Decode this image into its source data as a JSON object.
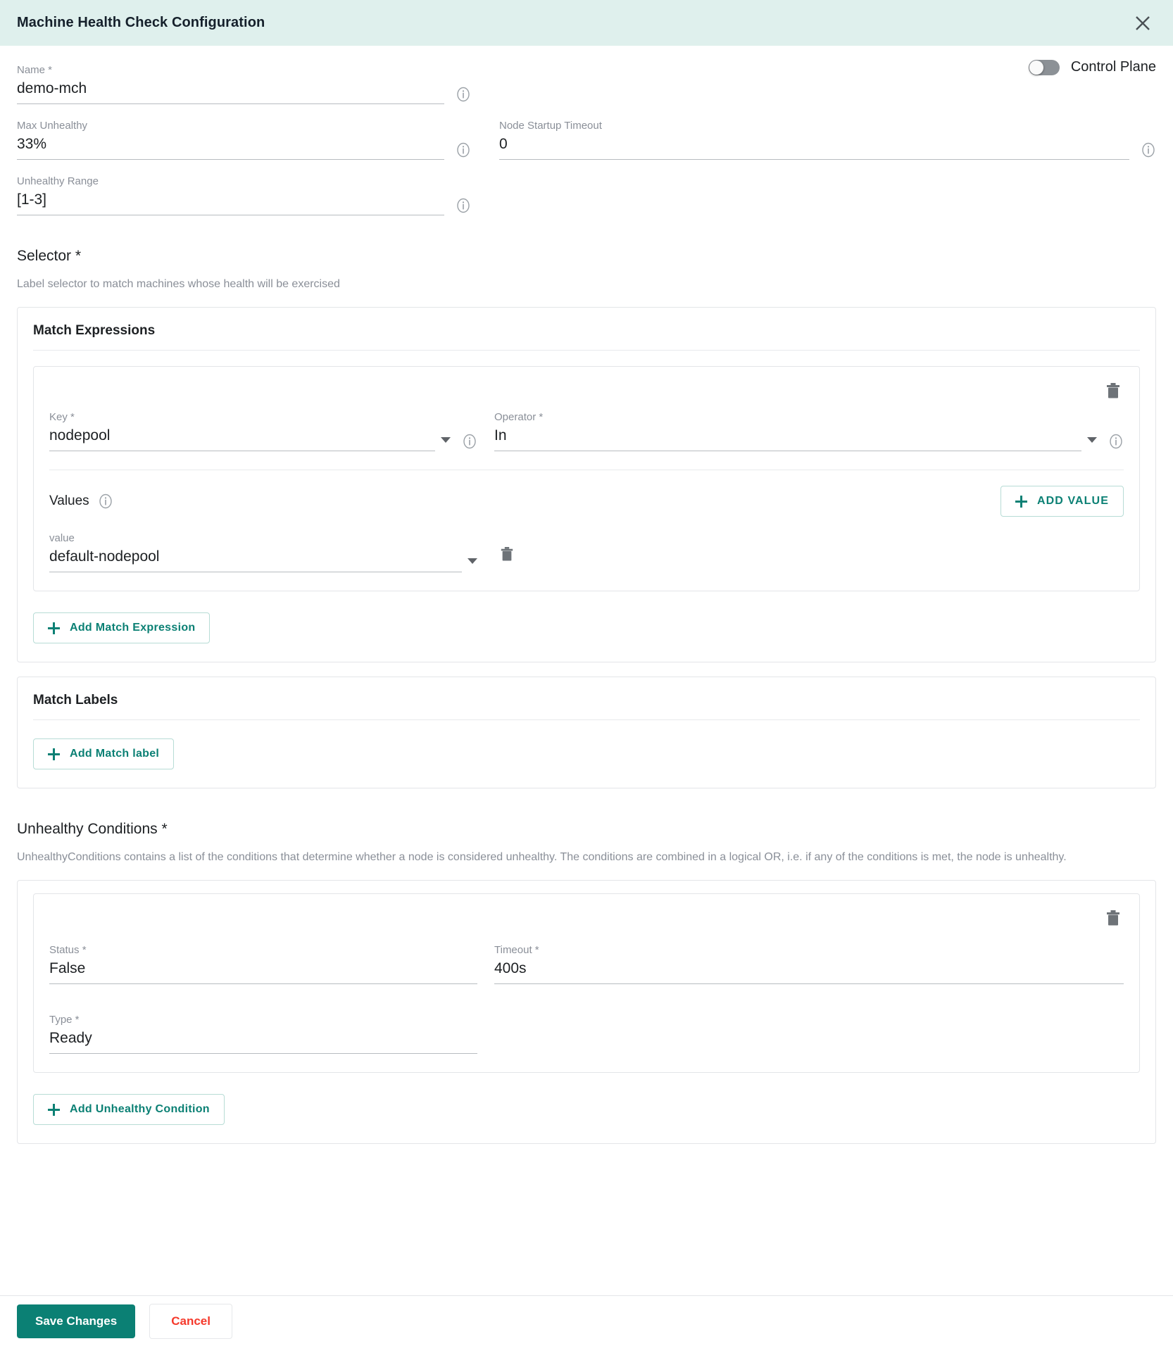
{
  "header": {
    "title": "Machine Health Check Configuration",
    "close_icon": "close-icon"
  },
  "toggle": {
    "label": "Control Plane",
    "state": "off"
  },
  "fields": {
    "name": {
      "label": "Name *",
      "value": "demo-mch"
    },
    "max_unhealthy": {
      "label": "Max Unhealthy",
      "value": "33%"
    },
    "node_startup_timeout": {
      "label": "Node Startup Timeout",
      "value": "0"
    },
    "unhealthy_range": {
      "label": "Unhealthy Range",
      "value": "[1-3]"
    }
  },
  "selector": {
    "title": "Selector *",
    "description": "Label selector to match machines whose health will be exercised",
    "match_expressions": {
      "heading": "Match Expressions",
      "expressions": [
        {
          "key": {
            "label": "Key *",
            "value": "nodepool"
          },
          "operator": {
            "label": "Operator *",
            "value": "In"
          },
          "values_title": "Values",
          "add_value_label": "ADD VALUE",
          "values": [
            {
              "label": "value",
              "value": "default-nodepool"
            }
          ]
        }
      ],
      "add_expression_label": "Add Match Expression"
    },
    "match_labels": {
      "heading": "Match Labels",
      "add_label": "Add Match label"
    }
  },
  "unhealthy_conditions": {
    "title": "Unhealthy Conditions *",
    "description": "UnhealthyConditions contains a list of the conditions that determine whether a node is considered unhealthy. The conditions are combined in a logical OR, i.e. if any of the conditions is met, the node is unhealthy.",
    "conditions": [
      {
        "status": {
          "label": "Status *",
          "value": "False"
        },
        "timeout": {
          "label": "Timeout *",
          "value": "400s"
        },
        "type": {
          "label": "Type *",
          "value": "Ready"
        }
      }
    ],
    "add_condition_label": "Add Unhealthy Condition"
  },
  "footer": {
    "save_label": "Save Changes",
    "cancel_label": "Cancel"
  },
  "colors": {
    "accent": "#0b8074",
    "header_bg": "#dff0ed",
    "danger": "#f5392b"
  }
}
